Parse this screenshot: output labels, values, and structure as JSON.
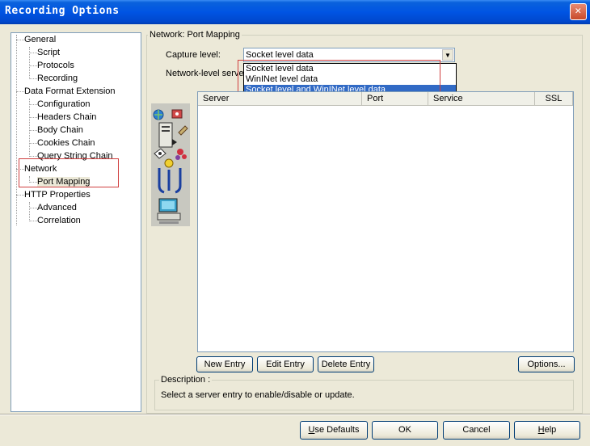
{
  "window": {
    "title": "Recording Options",
    "close_glyph": "✕"
  },
  "tree": {
    "items": [
      {
        "label": "General",
        "level": 0
      },
      {
        "label": "Script",
        "level": 1
      },
      {
        "label": "Protocols",
        "level": 1
      },
      {
        "label": "Recording",
        "level": 1
      },
      {
        "label": "Data Format Extension",
        "level": 0
      },
      {
        "label": "Configuration",
        "level": 1
      },
      {
        "label": "Headers Chain",
        "level": 1
      },
      {
        "label": "Body Chain",
        "level": 1
      },
      {
        "label": "Cookies Chain",
        "level": 1
      },
      {
        "label": "Query String Chain",
        "level": 1
      },
      {
        "label": "Network",
        "level": 0
      },
      {
        "label": "Port Mapping",
        "level": 1
      },
      {
        "label": "HTTP Properties",
        "level": 0
      },
      {
        "label": "Advanced",
        "level": 1
      },
      {
        "label": "Correlation",
        "level": 1
      }
    ],
    "selected": "Port Mapping"
  },
  "panel": {
    "title": "Network: Port Mapping",
    "capture_level_label": "Capture level:",
    "capture_level_value": "Socket level data",
    "network_server_label": "Network-level server",
    "dropdown_options": [
      "Socket level data",
      "WinINet level data",
      "Socket level and WinINet level data"
    ],
    "dropdown_selected": "Socket level and WinINet level data",
    "table_headers": [
      "Server",
      "Port",
      "Service",
      "SSL"
    ],
    "table_rows": []
  },
  "buttons": {
    "new_entry": "New Entry",
    "edit_entry": "Edit Entry",
    "delete_entry": "Delete Entry",
    "options": "Options...",
    "use_defaults_hotkey": "U",
    "use_defaults_rest": "se Defaults",
    "ok": "OK",
    "cancel": "Cancel",
    "help_hotkey": "H",
    "help_rest": "elp"
  },
  "description": {
    "title": "Description :",
    "text": "Select a server entry to enable/disable or update."
  },
  "colors": {
    "titlebar": "#0054e3",
    "selection": "#316ac5",
    "highlight_box": "#d04040"
  }
}
